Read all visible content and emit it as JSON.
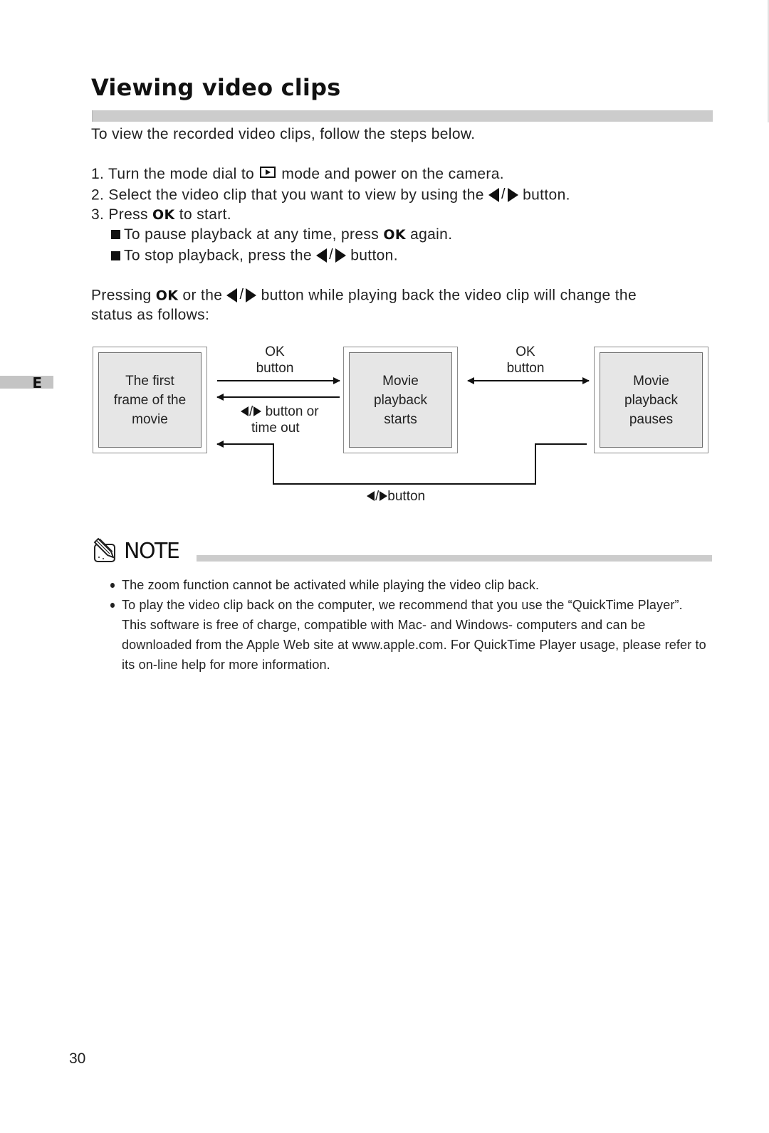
{
  "page": {
    "title": "Viewing video clips",
    "section_tab": "E",
    "page_number": "30"
  },
  "intro": "To view the recorded video clips, follow the steps below.",
  "steps": [
    {
      "number": "1.",
      "before": "Turn the mode dial to",
      "icon": "playback-mode-icon",
      "after": "mode and  power on the camera."
    },
    {
      "number": "2.",
      "before": "Select the video clip that you want to view by using the",
      "icon": "left-right-arrow-buttons",
      "after": "button."
    },
    {
      "number": "3.",
      "before": "Press",
      "key": "OK",
      "after": "to start."
    }
  ],
  "sub_steps": [
    {
      "before": "To pause playback at any time, press",
      "key": "OK",
      "after": "again."
    },
    {
      "before": "To stop playback, press the",
      "icon": "left-right-arrow-buttons",
      "after": "button."
    }
  ],
  "status_paragraph": {
    "part1": "Pressing",
    "key": "OK",
    "part2": "or the",
    "part3": "button while playing back the video clip will change the",
    "line2": "status as follows:"
  },
  "diagram": {
    "states": [
      {
        "id": "first-frame",
        "lines": [
          "The first",
          "frame of the",
          "movie"
        ]
      },
      {
        "id": "playback-starts",
        "lines": [
          "Movie",
          "playback",
          "starts"
        ]
      },
      {
        "id": "playback-pauses",
        "lines": [
          "Movie",
          "playback",
          "pauses"
        ]
      }
    ],
    "transitions": [
      {
        "from": "first-frame",
        "to": "playback-starts",
        "label_lines": [
          "OK",
          "button"
        ]
      },
      {
        "from": "playback-starts",
        "to": "first-frame",
        "label_lines": [
          "button or",
          "time out"
        ],
        "label_icon": "left-right-arrow-buttons"
      },
      {
        "from": "playback-starts",
        "to": "playback-pauses",
        "bidirectional": true,
        "label_lines": [
          "OK",
          "button"
        ]
      },
      {
        "from": "playback-pauses",
        "to": "first-frame",
        "label_lines": [
          "button"
        ],
        "label_icon": "left-right-arrow-buttons"
      }
    ],
    "slash": "/"
  },
  "note": {
    "heading": "NOTE",
    "icon": "note-pencil-icon",
    "items": [
      "The zoom function cannot be activated while playing the video clip back.",
      "To play the video clip back on the computer, we recommend that you use the “QuickTime Player”. This software is free of charge, compatible with Mac- and Windows- computers and can be downloaded from the Apple Web site at www.apple.com. For QuickTime Player usage, please refer to its on-line help for more information."
    ]
  }
}
